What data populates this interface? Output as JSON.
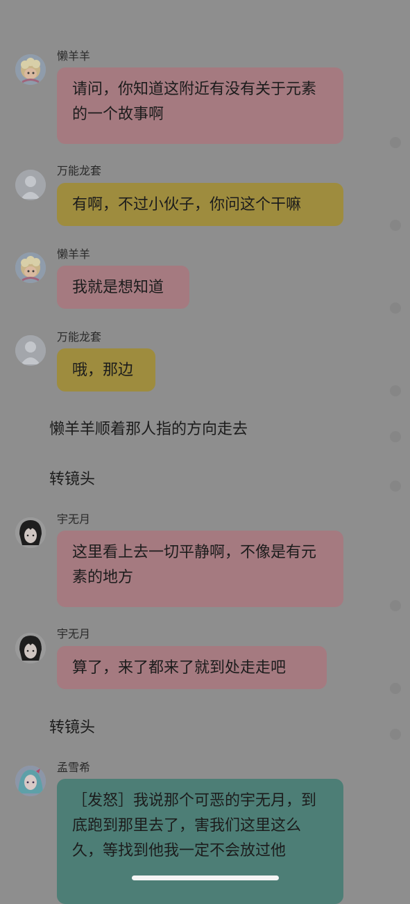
{
  "messages": [
    {
      "speaker": "懒羊羊",
      "avatar": "lazy-sheep-avatar",
      "text": "请问，你知道这附近有没有关于元素的一个故事啊",
      "bubble_color": "#a57a80"
    },
    {
      "speaker": "万能龙套",
      "avatar": "default-user-avatar",
      "text": "有啊，不过小伙子，你问这个干嘛",
      "bubble_color": "#9e8c3e"
    },
    {
      "speaker": "懒羊羊",
      "avatar": "lazy-sheep-avatar",
      "text": "我就是想知道",
      "bubble_color": "#a57a80"
    },
    {
      "speaker": "万能龙套",
      "avatar": "default-user-avatar",
      "text": "哦，那边",
      "bubble_color": "#9e8c3e"
    },
    {
      "narration": "懒羊羊顺着那人指的方向走去"
    },
    {
      "narration": "转镜头"
    },
    {
      "speaker": "宇无月",
      "avatar": "dark-hair-boy-avatar",
      "text": "这里看上去一切平静啊，不像是有元素的地方",
      "bubble_color": "#a57a80"
    },
    {
      "speaker": "宇无月",
      "avatar": "dark-hair-boy-avatar",
      "text": "算了，来了都来了就到处走走吧",
      "bubble_color": "#a57a80"
    },
    {
      "narration": "转镜头"
    },
    {
      "speaker": "孟雪希",
      "avatar": "anime-girl-avatar",
      "text": "［发怒］我说那个可恶的宇无月，到底跑到那里去了，害我们这里这么久，等找到他我一定不会放过他",
      "bubble_color": "#4d7e76"
    }
  ],
  "colors": {
    "overlay_background": "#8e8e8e",
    "pink_bubble": "#a57a80",
    "yellow_bubble": "#9e8c3e",
    "teal_bubble": "#4d7e76"
  }
}
